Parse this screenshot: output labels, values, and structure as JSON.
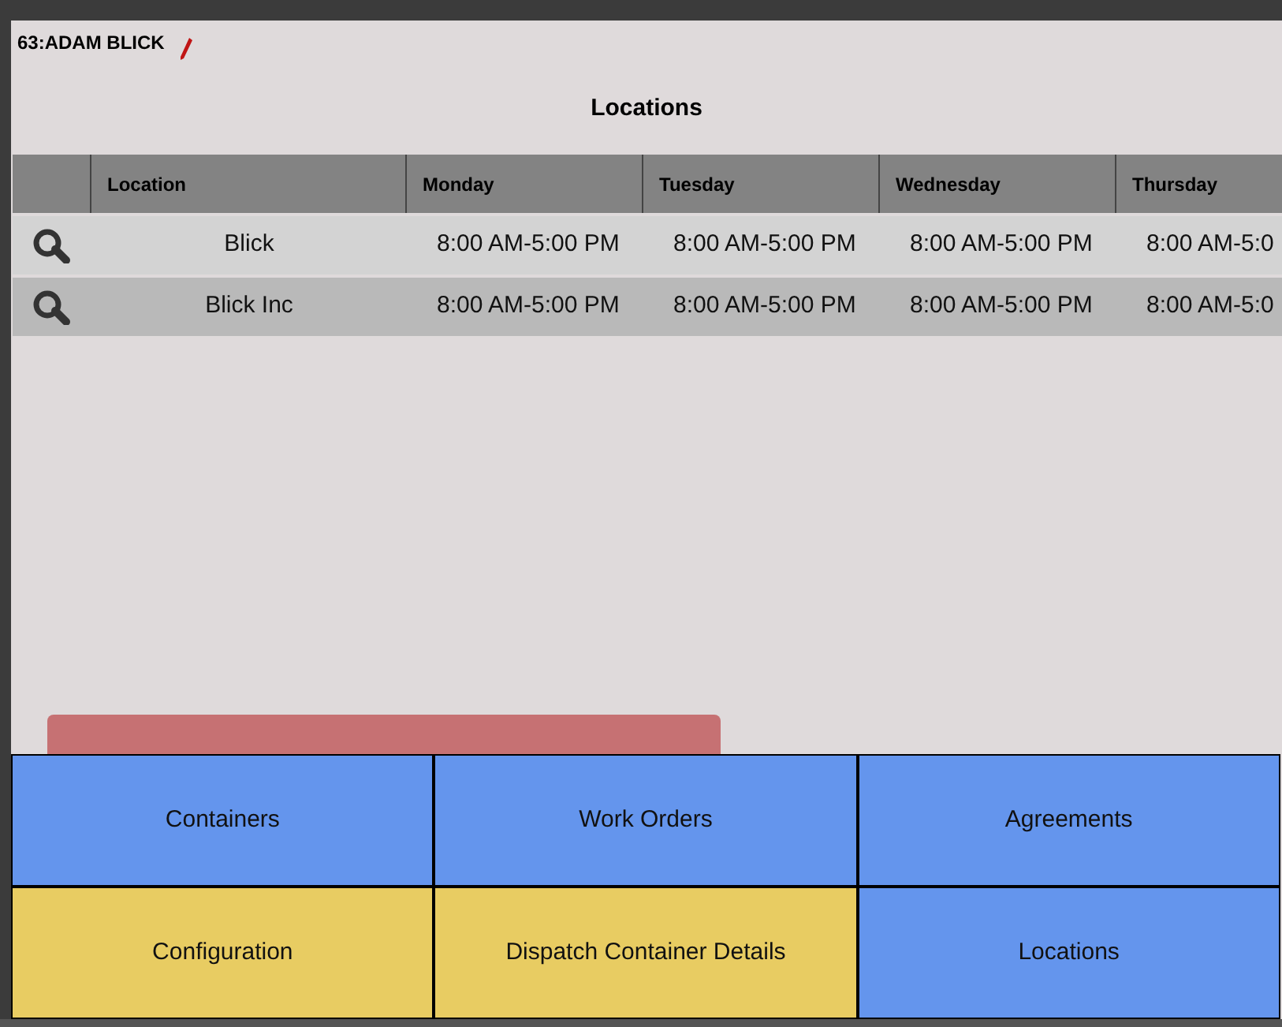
{
  "user": {
    "label": "63:ADAM BLICK"
  },
  "title": "Locations",
  "table": {
    "columns": [
      "Location",
      "Monday",
      "Tuesday",
      "Wednesday",
      "Thursday"
    ],
    "rows": [
      {
        "cells": [
          "Blick",
          "8:00 AM-5:00 PM",
          "8:00 AM-5:00 PM",
          "8:00 AM-5:00 PM",
          "8:00 AM-5:0"
        ]
      },
      {
        "cells": [
          "Blick Inc",
          "8:00 AM-5:00 PM",
          "8:00 AM-5:00 PM",
          "8:00 AM-5:00 PM",
          "8:00 AM-5:0"
        ]
      }
    ]
  },
  "buttons": [
    {
      "label": "Containers",
      "color": "#6495ed"
    },
    {
      "label": "Work Orders",
      "color": "#6495ed"
    },
    {
      "label": "Agreements",
      "color": "#6495ed"
    },
    {
      "label": "Configuration",
      "color": "#e8cc62"
    },
    {
      "label": "Dispatch Container Details",
      "color": "#e8cc62"
    },
    {
      "label": "Locations",
      "color": "#6495ed"
    }
  ]
}
